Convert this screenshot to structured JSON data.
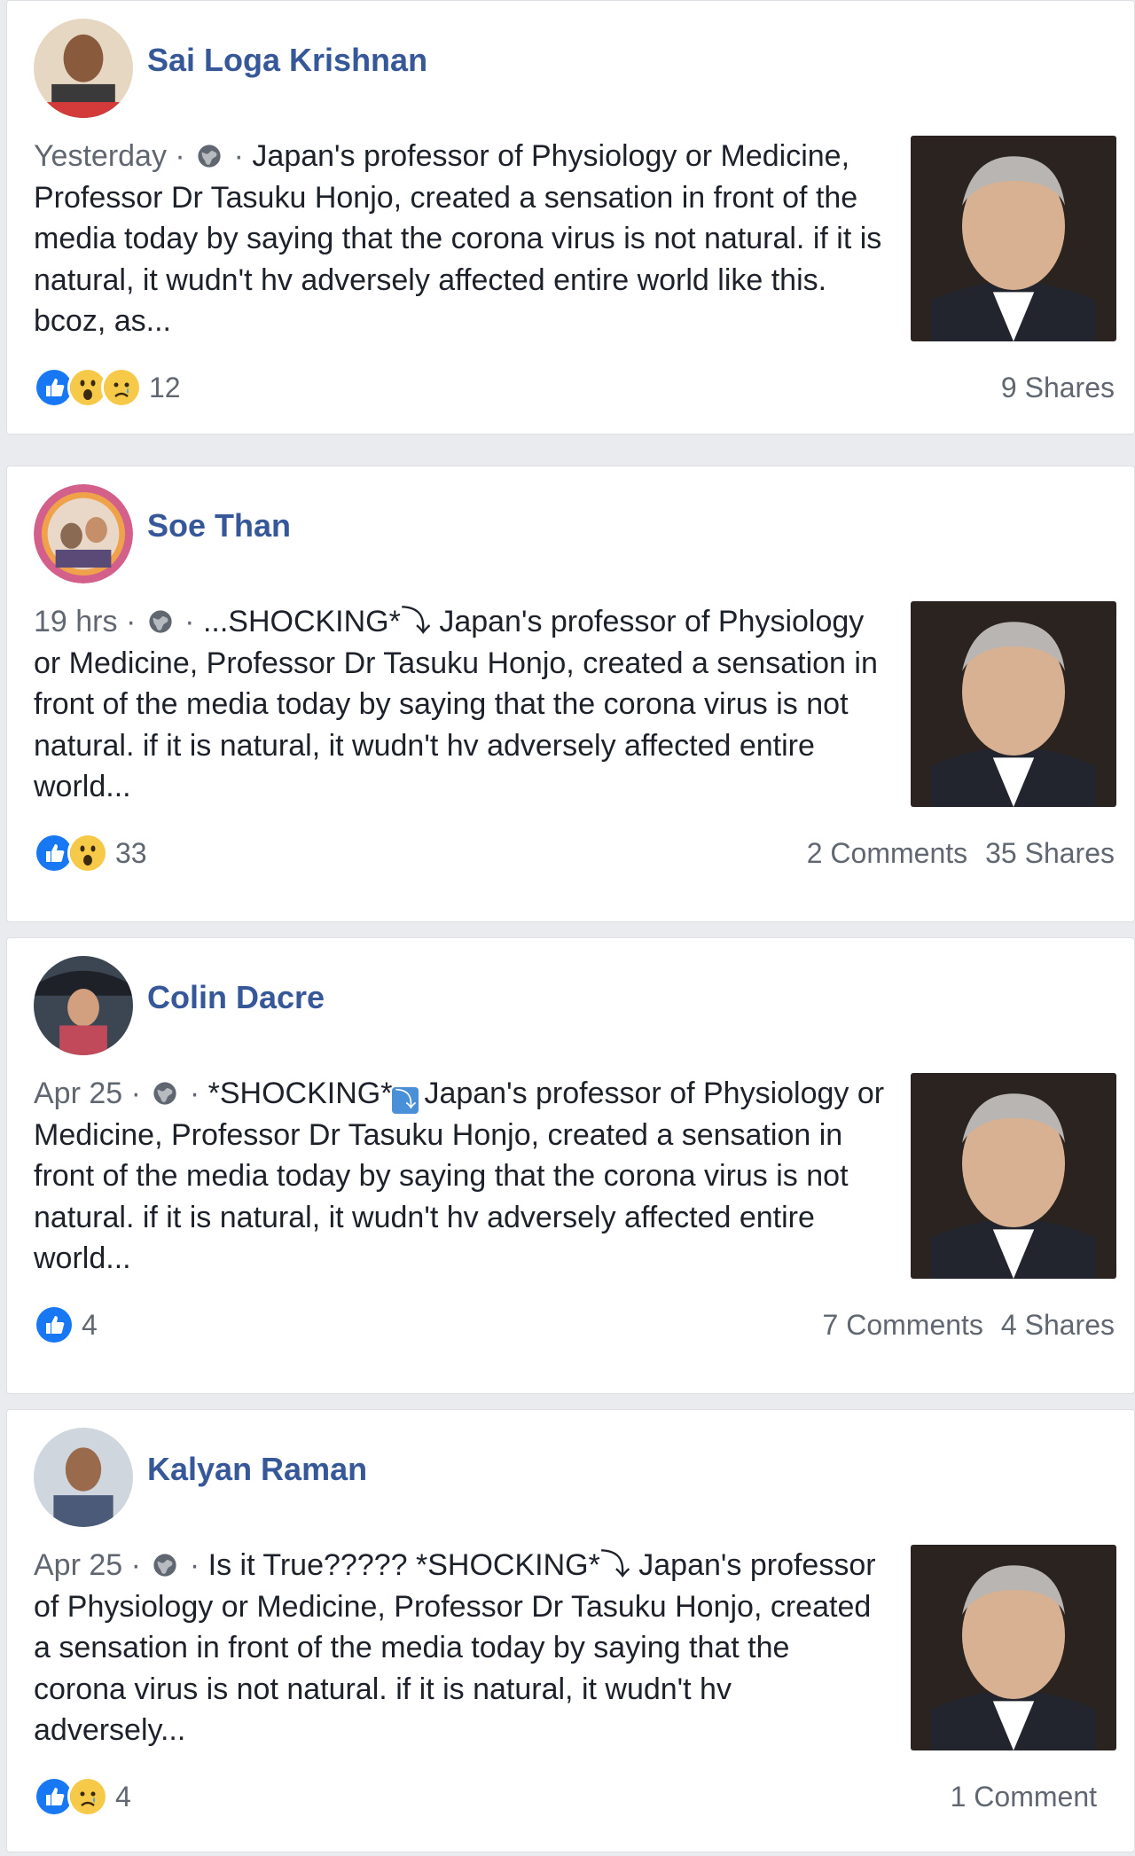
{
  "posts": [
    {
      "author": "Sai Loga Krishnan",
      "time": "Yesterday",
      "sep1": " · ",
      "sep2": " · ",
      "prefix": "",
      "text": "Japan's professor of Physiology or Medicine, Professor Dr Tasuku Honjo, created a sensation in front of the media today by saying that the corona virus is not natural. if it is natural, it wudn't hv adversely affected entire world like this. bcoz, as...",
      "reactions": [
        "like-icon",
        "wow-icon",
        "sad-icon"
      ],
      "reaction_count": "12",
      "comments": "",
      "shares": "9 Shares",
      "avatar_bg": "#c7a07a"
    },
    {
      "author": "Soe Than",
      "time": "19 hrs",
      "sep1": " · ",
      "sep2": " · ",
      "prefix": "...SHOCKING*⤵ ",
      "text": "Japan's professor of Physiology or Medicine, Professor Dr Tasuku Honjo, created a sensation in front of the media today by saying that the corona virus is not natural. if it is natural, it wudn't hv adversely affected entire world...",
      "reactions": [
        "like-icon",
        "wow-icon"
      ],
      "reaction_count": "33",
      "comments": "2 Comments",
      "shares": "35 Shares",
      "avatar_bg": "#d2608a"
    },
    {
      "author": "Colin Dacre",
      "time": "Apr 25",
      "sep1": " · ",
      "sep2": " · ",
      "prefix": "*SHOCKING*",
      "text": "Japan's professor of Physiology or Medicine, Professor Dr Tasuku Honjo, created a sensation in front of the media today by saying that the corona virus is not natural. if it is natural, it wudn't hv adversely affected entire world...",
      "reactions": [
        "like-icon"
      ],
      "reaction_count": "4",
      "comments": "7 Comments",
      "shares": "4 Shares",
      "avatar_bg": "#5b6a78"
    },
    {
      "author": "Kalyan Raman",
      "time": "Apr 25",
      "sep1": " · ",
      "sep2": " · ",
      "prefix": "Is it True????? *SHOCKING*⤵ ",
      "text": "Japan's professor of Physiology or Medicine, Professor Dr Tasuku Honjo, created a sensation in front of the media today by saying that the corona virus is not natural. if it is natural, it wudn't hv adversely...",
      "reactions": [
        "like-icon",
        "sad-icon"
      ],
      "reaction_count": "4",
      "comments": "1 Comment",
      "shares": "",
      "avatar_bg": "#9aa6b2"
    }
  ],
  "colors": {
    "author": "#365899",
    "meta": "#606770",
    "like": "#1877f2",
    "emoji": "#f7c948"
  }
}
